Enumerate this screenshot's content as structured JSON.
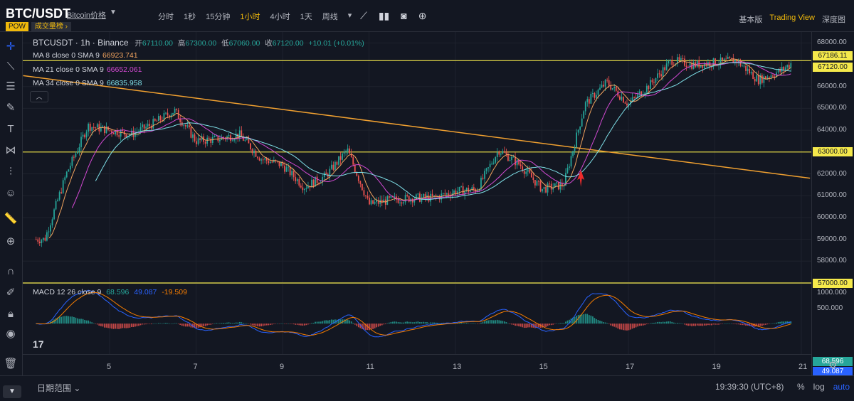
{
  "header": {
    "pair": "BTC/USDT",
    "pair_link": "Bitcoin价格",
    "tag_pow": "POW",
    "tag_rank": "成交量榜 ›",
    "intervals": [
      "分时",
      "1秒",
      "15分钟",
      "1小时",
      "4小时",
      "1天",
      "周线"
    ],
    "active_interval": "1小时",
    "views": [
      "基本版",
      "Trading View",
      "深度图"
    ],
    "active_view": "Trading View",
    "toolbar_icons": [
      "indicators-icon",
      "candle-type-icon",
      "camera-icon",
      "add-icon"
    ]
  },
  "legend": {
    "symbol_line": "BTCUSDT · 1h · Binance",
    "ohlc": {
      "open_label": "开",
      "open": "67110.00",
      "high_label": "高",
      "high": "67300.00",
      "low_label": "低",
      "low": "67060.00",
      "close_label": "收",
      "close": "67120.00",
      "change": "+10.01 (+0.01%)"
    },
    "ma8": {
      "label": "MA 8 close 0 SMA 9",
      "value": "66923.741",
      "color": "#f0a35e"
    },
    "ma21": {
      "label": "MA 21 close 0 SMA 9",
      "value": "66652.061",
      "color": "#d249d2"
    },
    "ma34": {
      "label": "MA 34 close 0 SMA 9",
      "value": "66835.958",
      "color": "#7fe0e8"
    },
    "macd": {
      "label": "MACD 12 26 close 9",
      "hist": "68.596",
      "macd": "49.087",
      "signal": "-19.509"
    }
  },
  "price_axis": {
    "labels": [
      "68000.00",
      "66000.00",
      "65000.00",
      "64000.00",
      "62000.00",
      "61000.00",
      "60000.00",
      "59000.00",
      "58000.00"
    ],
    "tags": [
      {
        "text": "67186.11",
        "bg": "#f5e94b"
      },
      {
        "text": "67120.00",
        "bg": "#f5e94b"
      },
      {
        "text": "63000.00",
        "bg": "#f5e94b"
      },
      {
        "text": "57000.00",
        "bg": "#f5e94b"
      }
    ],
    "macd_labels": [
      "1000.000",
      "500.000"
    ],
    "macd_tags": [
      {
        "text": "68.596",
        "bg": "#26a69a"
      },
      {
        "text": "49.087",
        "bg": "#2962ff"
      },
      {
        "text": "-19.509",
        "bg": "#f57c00"
      }
    ]
  },
  "time_axis": [
    "5",
    "7",
    "9",
    "11",
    "13",
    "15",
    "17",
    "19",
    "21"
  ],
  "footer": {
    "date_range": "日期范围 ⌄",
    "clock": "19:39:30 (UTC+8)",
    "scale_opts": [
      "%",
      "log",
      "auto"
    ],
    "active_scale": "auto"
  },
  "chart_data": {
    "type": "candlestick",
    "symbol": "BTCUSDT",
    "interval": "1h",
    "ylim": [
      57000,
      68500
    ],
    "x_ticks": [
      "5",
      "7",
      "9",
      "11",
      "13",
      "15",
      "17",
      "19",
      "21"
    ],
    "close_path": [
      {
        "day": 3.5,
        "close": 59000
      },
      {
        "day": 4.0,
        "close": 62000
      },
      {
        "day": 4.5,
        "close": 64200
      },
      {
        "day": 5.0,
        "close": 64000
      },
      {
        "day": 5.5,
        "close": 63800
      },
      {
        "day": 6.0,
        "close": 64300
      },
      {
        "day": 6.5,
        "close": 64900
      },
      {
        "day": 7.0,
        "close": 63500
      },
      {
        "day": 7.5,
        "close": 63600
      },
      {
        "day": 8.0,
        "close": 63800
      },
      {
        "day": 8.5,
        "close": 62700
      },
      {
        "day": 9.0,
        "close": 62400
      },
      {
        "day": 9.5,
        "close": 61400
      },
      {
        "day": 10.0,
        "close": 61900
      },
      {
        "day": 10.5,
        "close": 63100
      },
      {
        "day": 11.0,
        "close": 60600
      },
      {
        "day": 11.5,
        "close": 60800
      },
      {
        "day": 12.0,
        "close": 60900
      },
      {
        "day": 12.5,
        "close": 60900
      },
      {
        "day": 13.0,
        "close": 61200
      },
      {
        "day": 13.5,
        "close": 61300
      },
      {
        "day": 14.0,
        "close": 63100
      },
      {
        "day": 14.5,
        "close": 62400
      },
      {
        "day": 15.0,
        "close": 61300
      },
      {
        "day": 15.5,
        "close": 61500
      },
      {
        "day": 16.0,
        "close": 65200
      },
      {
        "day": 16.5,
        "close": 66200
      },
      {
        "day": 17.0,
        "close": 65200
      },
      {
        "day": 17.5,
        "close": 66100
      },
      {
        "day": 18.0,
        "close": 67200
      },
      {
        "day": 18.5,
        "close": 67000
      },
      {
        "day": 19.0,
        "close": 67100
      },
      {
        "day": 19.5,
        "close": 67200
      },
      {
        "day": 20.0,
        "close": 66300
      },
      {
        "day": 20.5,
        "close": 66700
      },
      {
        "day": 20.8,
        "close": 67120
      }
    ],
    "horizontal_lines": [
      67186.11,
      63000,
      57000
    ],
    "trendline": {
      "from": {
        "day": 3.0,
        "price": 66500
      },
      "to": {
        "day": 21.2,
        "price": 61800
      }
    },
    "macd_lim": [
      -1000,
      1100
    ]
  }
}
